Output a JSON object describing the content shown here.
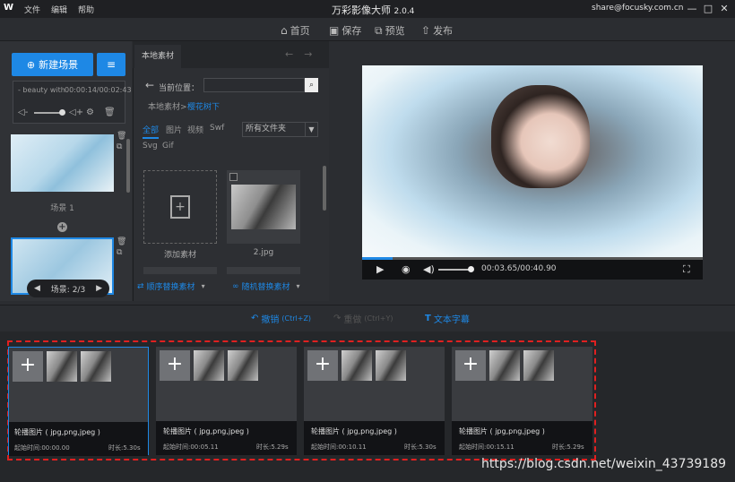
{
  "titlebar": {
    "logo": "W",
    "menu": [
      "文件",
      "编辑",
      "帮助"
    ],
    "title": "万彩影像大师",
    "version": "2.0.4",
    "email": "share@focusky.com.cn",
    "win_controls": [
      "—",
      "□",
      "✕"
    ]
  },
  "toolbar": {
    "home": "首页",
    "save": "保存",
    "preview": "预览",
    "publish": "发布"
  },
  "left": {
    "new_scene": "新建场景",
    "music_name": "- beauty with",
    "music_time": "00:00:14/00:02:43",
    "scene1_label": "场景 1",
    "scene_nav": "场景: 2/3"
  },
  "mid": {
    "tab": "本地素材",
    "path_label": "当前位置：",
    "crumb_root": "本地素材>",
    "crumb_current": "樱花树下",
    "file_types_row1": [
      "全部",
      "图片",
      "视频",
      "Swf"
    ],
    "file_types_row2": [
      "Svg",
      "Gif"
    ],
    "folder_select": "所有文件夹",
    "add_material": "添加素材",
    "image_name": "2.jpg",
    "seq_replace": "顺序替换素材",
    "rand_replace": "随机替换素材"
  },
  "player": {
    "timecode": "00:03.65/00:40.90",
    "progress": 0.09
  },
  "actions": {
    "undo": "撤销",
    "undo_hint": "(Ctrl+Z)",
    "redo": "重做",
    "redo_hint": "(Ctrl+Y)",
    "text_sub": "文本字幕"
  },
  "clips": [
    {
      "title": "轮播图片 ( jpg,png,jpeg )",
      "start": "起始时间:00:00.00",
      "duration": "时长:5.30s"
    },
    {
      "title": "轮播图片 ( jpg,png,jpeg )",
      "start": "起始时间:00:05.11",
      "duration": "时长:5.29s"
    },
    {
      "title": "轮播图片 ( jpg,png,jpeg )",
      "start": "起始时间:00:10.11",
      "duration": "时长:5.30s"
    },
    {
      "title": "轮播图片 ( jpg,png,jpeg )",
      "start": "起始时间:00:15.11",
      "duration": "时长:5.29s"
    }
  ],
  "watermark": "https://blog.csdn.net/weixin_43739189",
  "colors": {
    "accent": "#1e88e5",
    "highlight_border": "#e02020"
  }
}
